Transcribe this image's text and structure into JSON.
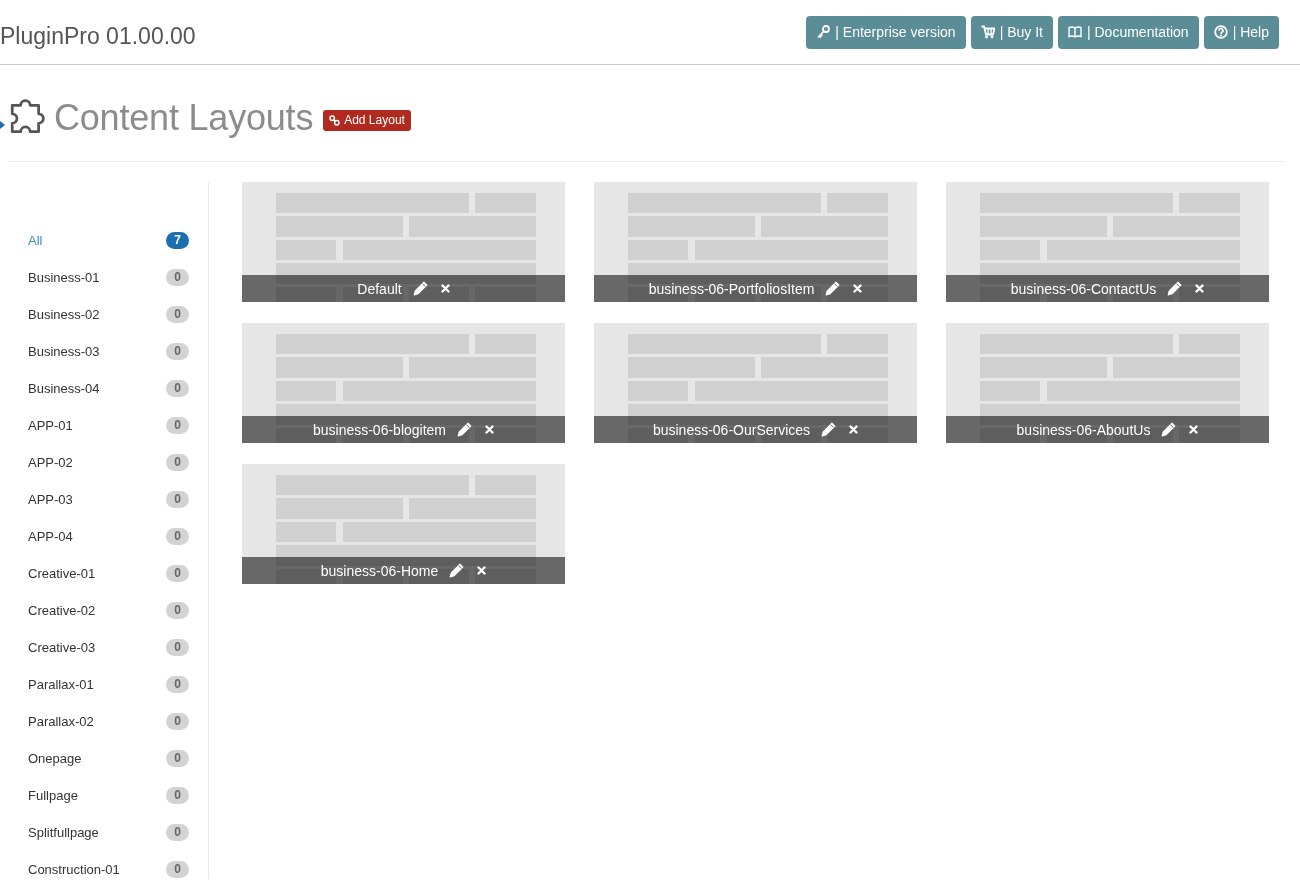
{
  "header": {
    "title": "PluginPro 01.00.00",
    "buttons": [
      {
        "label": "| Enterprise version"
      },
      {
        "label": "| Buy It"
      },
      {
        "label": "| Documentation"
      },
      {
        "label": "| Help"
      }
    ]
  },
  "section": {
    "title": "Content Layouts",
    "add_button": "Add Layout"
  },
  "sidebar": {
    "items": [
      {
        "label": "All",
        "count": "7",
        "selected": true
      },
      {
        "label": "Business-01",
        "count": "0",
        "selected": false
      },
      {
        "label": "Business-02",
        "count": "0",
        "selected": false
      },
      {
        "label": "Business-03",
        "count": "0",
        "selected": false
      },
      {
        "label": "Business-04",
        "count": "0",
        "selected": false
      },
      {
        "label": "APP-01",
        "count": "0",
        "selected": false
      },
      {
        "label": "APP-02",
        "count": "0",
        "selected": false
      },
      {
        "label": "APP-03",
        "count": "0",
        "selected": false
      },
      {
        "label": "APP-04",
        "count": "0",
        "selected": false
      },
      {
        "label": "Creative-01",
        "count": "0",
        "selected": false
      },
      {
        "label": "Creative-02",
        "count": "0",
        "selected": false
      },
      {
        "label": "Creative-03",
        "count": "0",
        "selected": false
      },
      {
        "label": "Parallax-01",
        "count": "0",
        "selected": false
      },
      {
        "label": "Parallax-02",
        "count": "0",
        "selected": false
      },
      {
        "label": "Onepage",
        "count": "0",
        "selected": false
      },
      {
        "label": "Fullpage",
        "count": "0",
        "selected": false
      },
      {
        "label": "Splitfullpage",
        "count": "0",
        "selected": false
      },
      {
        "label": "Construction-01",
        "count": "0",
        "selected": false
      }
    ]
  },
  "layouts": [
    {
      "name": "Default"
    },
    {
      "name": "business-06-PortfoliosItem"
    },
    {
      "name": "business-06-ContactUs"
    },
    {
      "name": "business-06-blogitem"
    },
    {
      "name": "business-06-OurServices"
    },
    {
      "name": "business-06-AboutUs"
    },
    {
      "name": "business-06-Home"
    }
  ]
}
